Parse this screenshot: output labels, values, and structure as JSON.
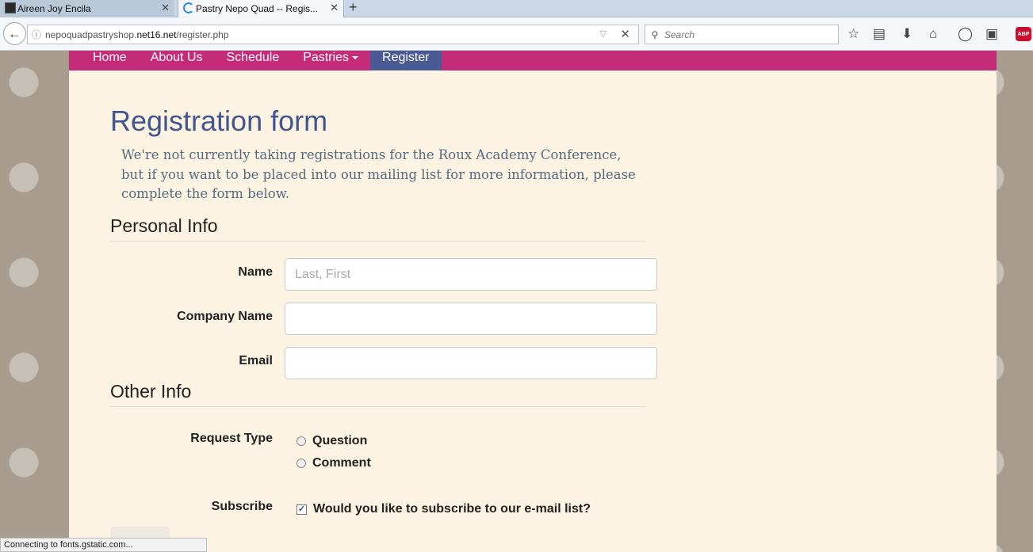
{
  "browser": {
    "tabs": [
      {
        "title": "Aireen Joy Encila",
        "close": "✕"
      },
      {
        "title": "Pastry Nepo Quad -- Regis...",
        "close": "✕"
      }
    ],
    "new_tab": "+",
    "url_prefix": "nepoquadpastryshop.",
    "url_host": "net16.net",
    "url_path": "/register.php",
    "search_placeholder": "Search",
    "abp_label": "ABP",
    "status": "Connecting to fonts.gstatic.com..."
  },
  "site_nav": {
    "items": [
      "Home",
      "About Us",
      "Schedule",
      "Pastries",
      "Register"
    ],
    "active": "Register"
  },
  "form": {
    "title": "Registration form",
    "intro": "We're not currently taking registrations for the Roux Academy Conference, but if you want to be placed into our mailing list for more information, please complete the form below.",
    "personal_heading": "Personal Info",
    "name_label": "Name",
    "name_placeholder": "Last, First",
    "company_label": "Company Name",
    "email_label": "Email",
    "other_heading": "Other Info",
    "request_label": "Request Type",
    "request_options": [
      "Question",
      "Comment"
    ],
    "subscribe_label": "Subscribe",
    "subscribe_text": "Would you like to subscribe to our e-mail list?",
    "subscribe_checked": true
  },
  "colors": {
    "nav_bg": "#c42b78",
    "nav_active": "#4a5a95",
    "title": "#41568f",
    "content_bg": "#fcf3e2"
  }
}
